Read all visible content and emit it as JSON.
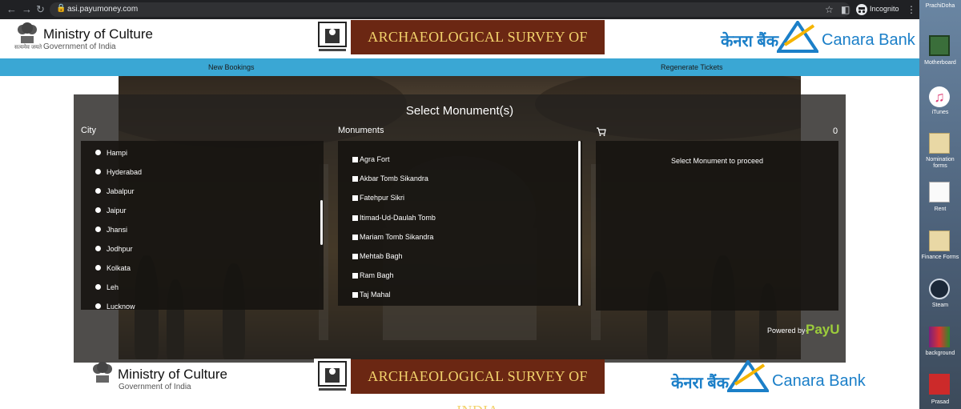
{
  "browser": {
    "url": "asi.payumoney.com",
    "profile_label": "Incognito"
  },
  "header": {
    "ministry_title": "Ministry of Culture",
    "ministry_subtitle": "Government of India",
    "emblem_motto": "सत्यमेव जयते",
    "asi_title": "ARCHAEOLOGICAL SURVEY OF INDIA",
    "bank_hindi": "केनरा बैंक",
    "bank_name": "Canara Bank"
  },
  "navbar": {
    "new_bookings": "New Bookings",
    "regenerate_tickets": "Regenerate Tickets"
  },
  "booking": {
    "title": "Select Monument(s)",
    "city_label": "City",
    "monuments_label": "Monuments",
    "cart_count": "0",
    "cart_message": "Select Monument to proceed",
    "cities": [
      "Hampi",
      "Hyderabad",
      "Jabalpur",
      "Jaipur",
      "Jhansi",
      "Jodhpur",
      "Kolkata",
      "Leh",
      "Lucknow"
    ],
    "monuments": [
      "Agra Fort",
      "Akbar Tomb Sikandra",
      "Fatehpur Sikri",
      "Itimad-Ud-Daulah Tomb",
      "Mariam Tomb Sikandra",
      "Mehtab Bagh",
      "Ram Bagh",
      "Taj Mahal"
    ],
    "powered_by": "Powered by-",
    "payu": "PayU"
  },
  "footer": {
    "ministry_title": "Ministry of Culture",
    "ministry_subtitle": "Government of India",
    "asi_title": "ARCHAEOLOGICAL SURVEY OF INDIA",
    "bank_hindi": "केनरा बैंक",
    "bank_name": "Canara Bank"
  },
  "desktop": {
    "icons": [
      "PrachiDoha",
      "Motherboard",
      "iTunes",
      "Nomination forms",
      "Rent",
      "Finance Forms",
      "Steam",
      "background",
      "Prasad"
    ]
  }
}
